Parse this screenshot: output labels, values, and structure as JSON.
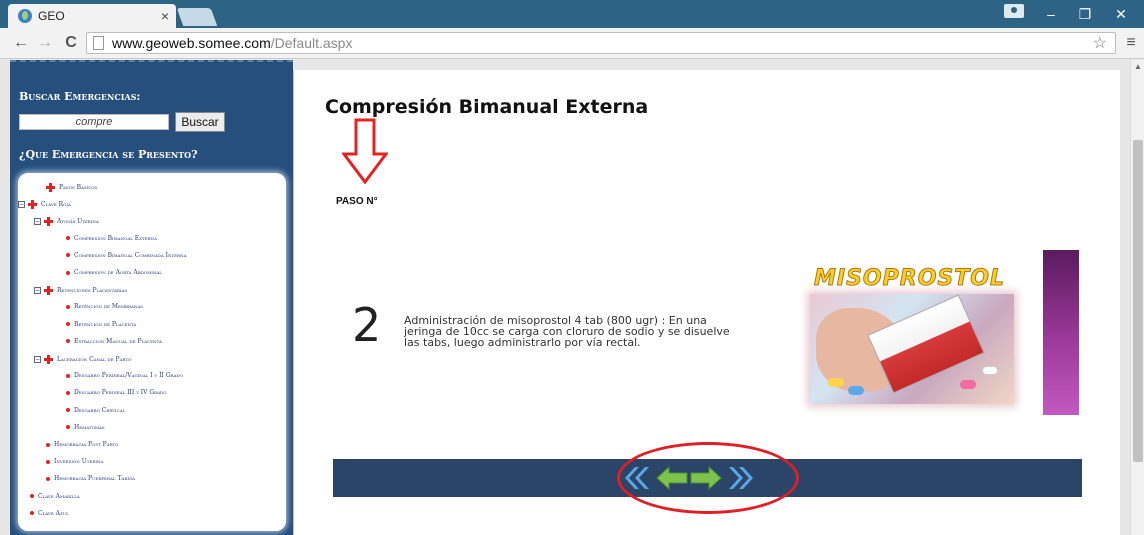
{
  "browser": {
    "tab_title": "GEO",
    "tab_close": "×",
    "url_host": "www.geoweb.somee.com",
    "url_path": "/Default.aspx",
    "back": "←",
    "forward": "→",
    "reload": "C",
    "menu": "≡",
    "star": "☆",
    "minimize": "–",
    "maximize": "❐",
    "close": "✕"
  },
  "sidebar": {
    "search_heading": "Buscar Emergencias:",
    "search_value": "compre",
    "search_button": "Buscar",
    "question_heading": "¿Que Emergencia se Presento?",
    "tree": [
      {
        "label": "Pasos Básicos",
        "icon": "cross",
        "toggle": null
      },
      {
        "label": "Clave Roja",
        "icon": "cross",
        "toggle": "⊟"
      },
      {
        "label": "Atonía Uterina",
        "icon": "cross",
        "toggle": "⊟"
      },
      {
        "label": "Compresión Bimanual Externa",
        "icon": "dot",
        "toggle": null
      },
      {
        "label": "Compresión Bimanual Combinada Interna",
        "icon": "dot",
        "toggle": null
      },
      {
        "label": "Compresión de Aorta Abdominal",
        "icon": "dot",
        "toggle": null
      },
      {
        "label": "Retenciones Placentarias",
        "icon": "cross",
        "toggle": "⊟"
      },
      {
        "label": "Retencion de Membranas",
        "icon": "dot",
        "toggle": null
      },
      {
        "label": "Retencion de Placenta",
        "icon": "dot",
        "toggle": null
      },
      {
        "label": "Extraccion Manual de Placenta",
        "icon": "dot",
        "toggle": null
      },
      {
        "label": "Laceracion Canal de Parto",
        "icon": "cross",
        "toggle": "⊟"
      },
      {
        "label": "Desgarro Perineal/Vaginal I y II Grado",
        "icon": "dot",
        "toggle": null
      },
      {
        "label": "Desgarro Perineal III y IV Grado",
        "icon": "dot",
        "toggle": null
      },
      {
        "label": "Desgarro Cervical",
        "icon": "dot",
        "toggle": null
      },
      {
        "label": "Hematomas",
        "icon": "dot",
        "toggle": null
      },
      {
        "label": "Hemorragia Post Parto",
        "icon": "dot",
        "toggle": null
      },
      {
        "label": "Inversión Uterina",
        "icon": "dot",
        "toggle": null
      },
      {
        "label": "Hemorragia Puerperal Tardía",
        "icon": "dot",
        "toggle": null
      },
      {
        "label": "Clave Amarilla",
        "icon": "dot",
        "toggle": null
      },
      {
        "label": "Clave Azul",
        "icon": "dot",
        "toggle": null
      }
    ]
  },
  "main": {
    "title": "Compresión Bimanual Externa",
    "paso_label": "PASO N°",
    "step_number": "2",
    "step_text": "Administración de misoprostol 4 tab (800 ugr) : En una jeringa de 10cc se carga con cloruro de sodio y se disuelve las tabs, luego administrarlo por vía rectal.",
    "product_label": "MISOPROSTOL"
  },
  "colors": {
    "sidebar_bg": "#264f7d",
    "nav_bar_bg": "#2b4568",
    "accent_red": "#e32222",
    "arrow_green": "#7dc24b",
    "arrow_blue": "#5aa8e8"
  },
  "icons": [
    "arrow-down-icon",
    "first-page-icon",
    "prev-page-icon",
    "next-page-icon",
    "last-page-icon",
    "star-icon",
    "reload-icon"
  ]
}
